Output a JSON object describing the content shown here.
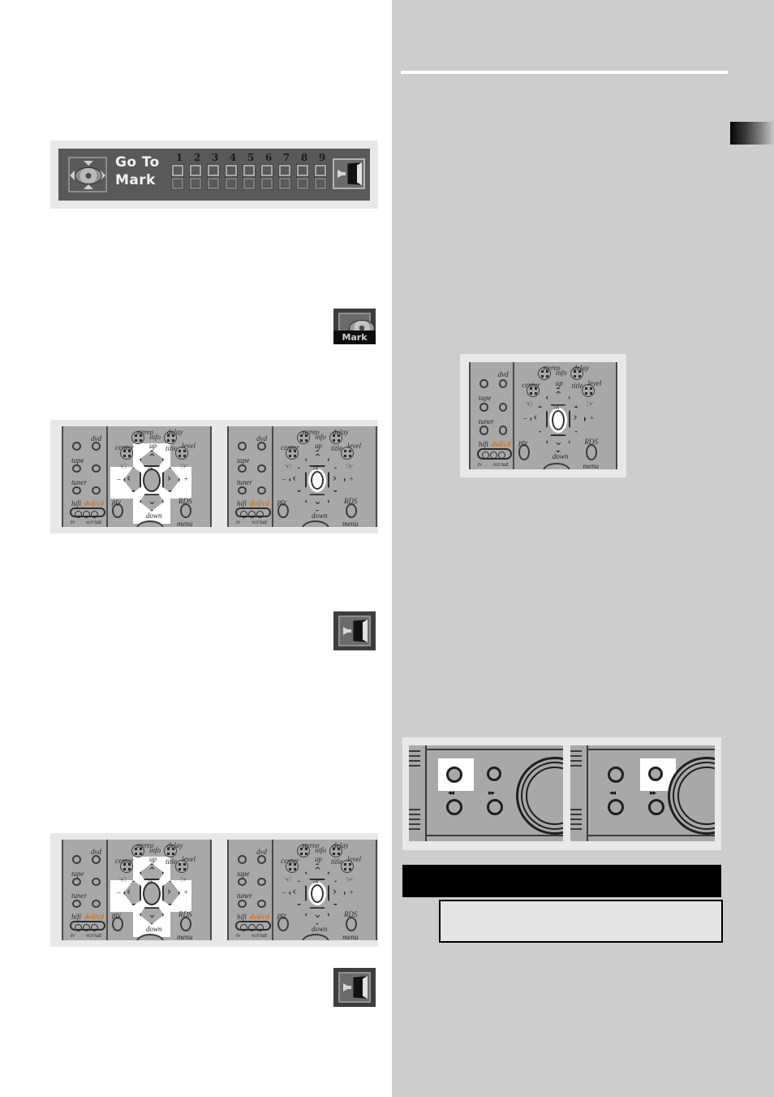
{
  "page": {
    "background_left": "#ffffff",
    "background_right": "#cdcdcd"
  },
  "osd_panel": {
    "name": "Go To Mark on-screen display",
    "title_line1": "Go To",
    "title_line2": "Mark",
    "disc_icon": "disc-navigation-icon",
    "numbers": [
      "1",
      "2",
      "3",
      "4",
      "5",
      "6",
      "7",
      "8",
      "9"
    ],
    "checkbox_rows": [
      {
        "row": "top",
        "checked": [
          false,
          false,
          false,
          false,
          false,
          false,
          false,
          false,
          false
        ]
      },
      {
        "row": "bottom",
        "checked": [
          false,
          false,
          false,
          false,
          false,
          false,
          false,
          false,
          false
        ]
      }
    ],
    "exit_button": "exit-door-icon",
    "panel_color": "#595959",
    "frame_color": "#e8e8e8"
  },
  "badges": [
    {
      "id": "mark-badge",
      "icon": "disc-mark-icon",
      "caption": "Mark"
    },
    {
      "id": "exit-badge-1",
      "icon": "exit-door-icon",
      "caption": ""
    },
    {
      "id": "exit-badge-2",
      "icon": "exit-door-icon",
      "caption": ""
    }
  ],
  "remote": {
    "source_buttons": [
      "dvd",
      "tape",
      "tuner"
    ],
    "top_labels": [
      "stereo",
      "delay",
      "info",
      "up",
      "title",
      "level",
      "center"
    ],
    "bottom_labels": [
      "pty",
      "RDS",
      "down",
      "menu"
    ],
    "mode_labels": {
      "hifi": "hifi",
      "dvdcd": "dvd/cd",
      "tv": "tv",
      "vcrsat": "vcr/sat"
    },
    "minus": "–",
    "plus": "+",
    "ok_label": "ok",
    "chevrons": {
      "up": "⌃",
      "down": "⌄",
      "left": "‹",
      "right": "›"
    },
    "hand_glyph": "☞"
  },
  "figures": [
    {
      "id": "figure-remote-1",
      "caption": "",
      "panes": 2,
      "highlight": "navigation-pad"
    },
    {
      "id": "figure-remote-2",
      "caption": "",
      "panes": 1,
      "highlight": "ok-button"
    },
    {
      "id": "figure-remote-3",
      "caption": "",
      "panes": 2,
      "highlight": "navigation-pad"
    },
    {
      "id": "figure-front-panel",
      "caption": "",
      "panes": 2,
      "highlight": "transport-button"
    }
  ],
  "front_panel": {
    "rewind_marker": "◂◂",
    "forward_marker": "▸▸",
    "buttons": [
      "stop",
      "play",
      "skip-back",
      "skip-forward"
    ],
    "dial": "jog-dial"
  },
  "callouts": {
    "black_bar_text": "",
    "note_box_text": ""
  },
  "edge_tab": {
    "name": "chapter-thumb-tab",
    "gradient_from": "#050505",
    "gradient_to": "#c9c9c9"
  }
}
